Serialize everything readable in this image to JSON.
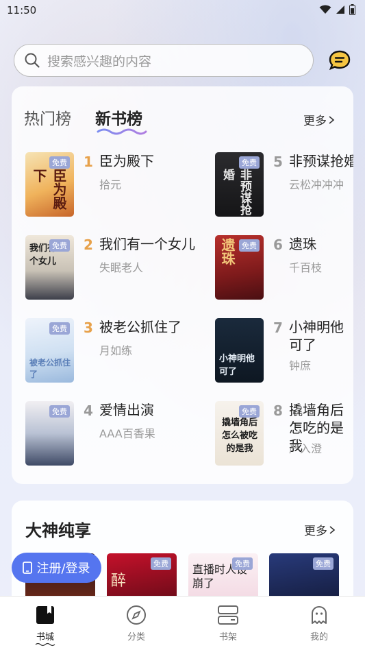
{
  "status": {
    "time": "11:50"
  },
  "search": {
    "placeholder": "搜索感兴趣的内容"
  },
  "ranking": {
    "tabs": [
      {
        "label": "热门榜"
      },
      {
        "label": "新书榜"
      }
    ],
    "more": "更多",
    "books": [
      {
        "rank": "1",
        "title": "臣为殿下",
        "author": "拾元",
        "badge": "免费",
        "cover_text": "臣为殿下"
      },
      {
        "rank": "2",
        "title": "我们有一个女儿",
        "author": "失眠老人",
        "badge": "免费",
        "cover_text": "我们有一个女儿"
      },
      {
        "rank": "3",
        "title": "被老公抓住了",
        "author": "月如练",
        "badge": "免费",
        "cover_text": "被老公抓住了"
      },
      {
        "rank": "4",
        "title": "爱情出演",
        "author": "AAA百香果",
        "badge": "免费",
        "cover_text": ""
      },
      {
        "rank": "5",
        "title": "非预谋抢婚",
        "author": "云松冲冲冲",
        "badge": "免费",
        "cover_text": "非预谋抢婚"
      },
      {
        "rank": "6",
        "title": "遗珠",
        "author": "千百枝",
        "badge": "免费",
        "cover_text": "遗珠"
      },
      {
        "rank": "7",
        "title": "小神明他可了",
        "author": "钟庶",
        "badge": "免费",
        "cover_text": "小神明他可了"
      },
      {
        "rank": "8",
        "title": "撬墙角后怎吃的是我",
        "author": "严入澄",
        "badge": "免费",
        "cover_text": "撬墙角后怎么被吃的是我"
      }
    ]
  },
  "section2": {
    "title": "大神纯享",
    "more": "更多",
    "badge": "免费",
    "covers": [
      {
        "text": ""
      },
      {
        "text": "醉"
      },
      {
        "text": "直播时人设崩了"
      },
      {
        "text": ""
      }
    ]
  },
  "login_button": {
    "label": "注册/登录"
  },
  "nav": {
    "items": [
      {
        "label": "书城",
        "icon": "bookstore-icon"
      },
      {
        "label": "分类",
        "icon": "compass-icon"
      },
      {
        "label": "书架",
        "icon": "bookshelf-icon"
      },
      {
        "label": "我的",
        "icon": "ghost-icon"
      }
    ]
  },
  "colors": {
    "accent": "#5575ef",
    "rank_top": "#e7a14a",
    "badge": "#9aa6d6"
  }
}
